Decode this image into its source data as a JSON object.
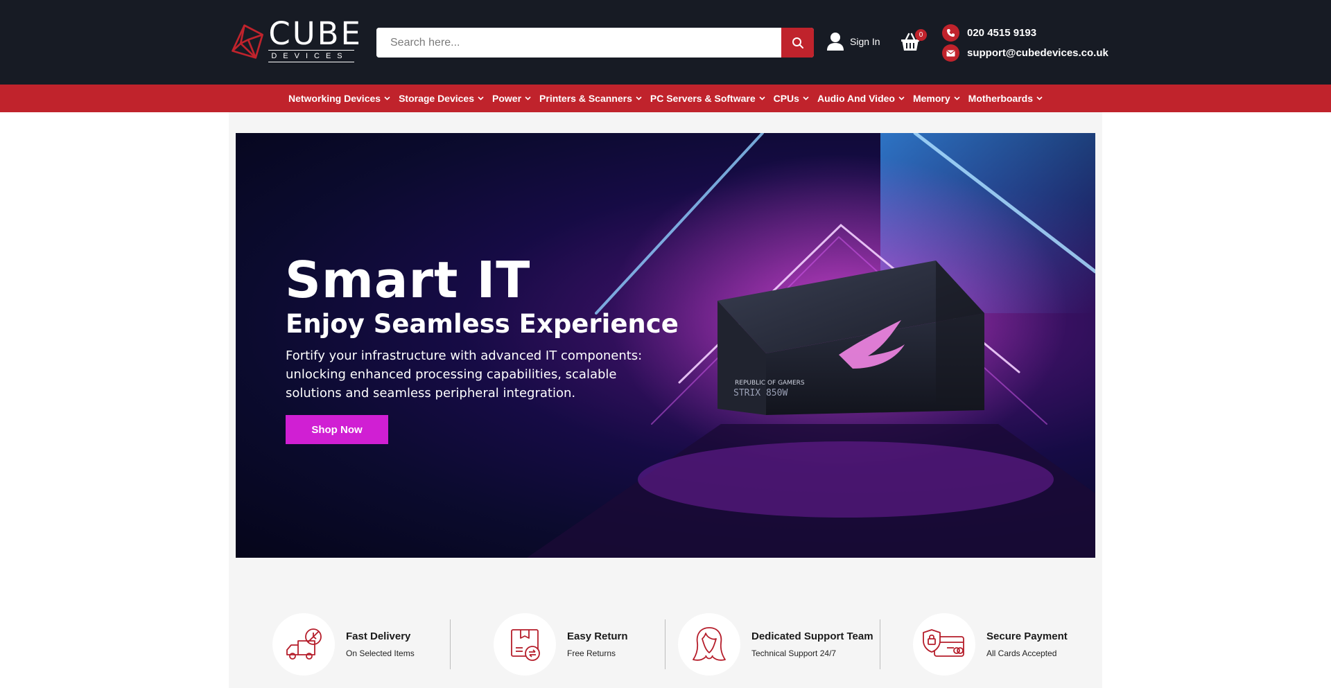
{
  "brand": {
    "name": "CUBE",
    "tagline": "DEVICES"
  },
  "search": {
    "placeholder": "Search here..."
  },
  "account": {
    "signin_label": "Sign In"
  },
  "cart": {
    "count": "0"
  },
  "contact": {
    "phone": "020 4515 9193",
    "email": "support@cubedevices.co.uk"
  },
  "nav": {
    "items": [
      {
        "label": "Networking Devices"
      },
      {
        "label": "Storage Devices"
      },
      {
        "label": "Power"
      },
      {
        "label": "Printers & Scanners"
      },
      {
        "label": "PC Servers & Software"
      },
      {
        "label": "CPUs"
      },
      {
        "label": "Audio And Video"
      },
      {
        "label": "Memory"
      },
      {
        "label": "Motherboards"
      }
    ]
  },
  "hero": {
    "title": "Smart IT",
    "subtitle": "Enjoy Seamless Experience",
    "description": "Fortify your infrastructure with advanced IT components: unlocking enhanced processing capabilities, scalable solutions and seamless peripheral integration.",
    "cta_label": "Shop Now",
    "product_line1": "REPUBLIC OF GAMERS",
    "product_line2": "STRIX 850W"
  },
  "features": [
    {
      "title": "Fast Delivery",
      "subtitle": "On Selected Items",
      "icon": "delivery-truck-icon"
    },
    {
      "title": "Easy Return",
      "subtitle": "Free Returns",
      "icon": "return-box-icon"
    },
    {
      "title": "Dedicated Support Team",
      "subtitle": "Technical Support 24/7",
      "icon": "support-agent-icon"
    },
    {
      "title": "Secure Payment",
      "subtitle": "All Cards Accepted",
      "icon": "secure-card-icon"
    }
  ],
  "colors": {
    "header_bg": "#171b24",
    "accent": "#c0232c",
    "cta": "#d01fd3",
    "content_bg": "#f5f5f5"
  }
}
